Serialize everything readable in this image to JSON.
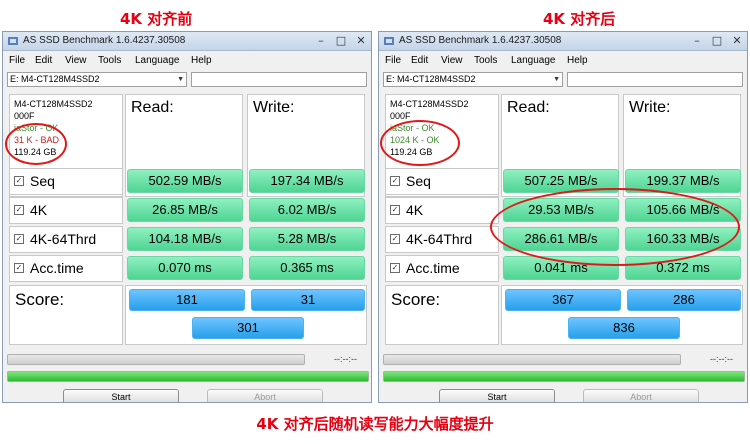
{
  "headings": {
    "left": "4K 对齐前",
    "right": "4K 对齐后"
  },
  "caption": "4K 对齐后随机读写能力大幅度提升",
  "common": {
    "window_title": "AS SSD Benchmark 1.6.4237.30508",
    "menu": [
      "File",
      "Edit",
      "View",
      "Tools",
      "Language",
      "Help"
    ],
    "drive_select": "E: M4-CT128M4SSD2",
    "col_read": "Read:",
    "col_write": "Write:",
    "rows": [
      "Seq",
      "4K",
      "4K-64Thrd",
      "Acc.time"
    ],
    "score_label": "Score:",
    "time_display": "--:--:--",
    "start_label": "Start",
    "abort_label": "Abort",
    "title_buttons": [
      "–",
      "□",
      "✕"
    ],
    "checkbox_mark": "✓"
  },
  "panels": [
    {
      "device": "M4-CT128M4SSD2",
      "firmware": "000F",
      "driver": "iaStor - OK",
      "alignment": "31 K - BAD",
      "capacity": "119.24 GB",
      "read": [
        "502.59 MB/s",
        "26.85 MB/s",
        "104.18 MB/s",
        "0.070 ms"
      ],
      "write": [
        "197.34 MB/s",
        "6.02 MB/s",
        "5.28 MB/s",
        "0.365 ms"
      ],
      "score_read": "181",
      "score_write": "31",
      "score_total": "301",
      "progress_pct": 100
    },
    {
      "device": "M4-CT128M4SSD2",
      "firmware": "000F",
      "driver": "iaStor - OK",
      "alignment": "1024 K - OK",
      "capacity": "119.24 GB",
      "read": [
        "507.25 MB/s",
        "29.53 MB/s",
        "286.61 MB/s",
        "0.041 ms"
      ],
      "write": [
        "199.37 MB/s",
        "105.66 MB/s",
        "160.33 MB/s",
        "0.372 ms"
      ],
      "score_read": "367",
      "score_write": "286",
      "score_total": "836",
      "progress_pct": 100
    }
  ],
  "colors": {
    "accent_red": "#e60012",
    "result_green": "#4ed493",
    "score_blue": "#26a0ea"
  }
}
